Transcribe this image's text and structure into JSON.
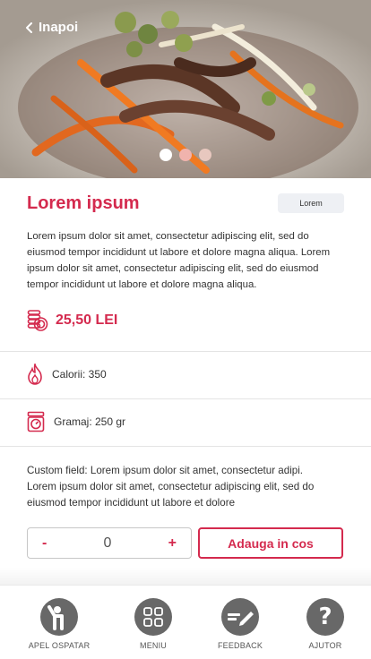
{
  "header": {
    "back_label": "Inapoi"
  },
  "carousel": {
    "slide_count": 3,
    "active_index": 0
  },
  "product": {
    "title": "Lorem ipsum",
    "tag": "Lorem",
    "description": "Lorem ipsum dolor sit amet, consectetur adipiscing elit, sed do eiusmod tempor incididunt ut labore et dolore magna aliqua. Lorem ipsum dolor sit amet, consectetur adipiscing elit, sed do eiusmod tempor incididunt ut labore et dolore magna aliqua.",
    "price": "25,50 LEI",
    "calories": "Calorii: 350",
    "weight": "Gramaj: 250 gr",
    "custom_field": "Custom field: Lorem ipsum dolor sit amet, consectetur adipi. Lorem ipsum dolor sit amet, consectetur adipiscing elit, sed do eiusmod tempor incididunt ut labore et dolore"
  },
  "cart": {
    "minus_label": "-",
    "quantity": "0",
    "plus_label": "+",
    "add_label": "Adauga in cos"
  },
  "nav": {
    "items": [
      {
        "label": "APEL OSPATAR",
        "icon": "waiter-icon"
      },
      {
        "label": "MENIU",
        "icon": "grid-icon"
      },
      {
        "label": "FEEDBACK",
        "icon": "feedback-pen-icon"
      },
      {
        "label": "AJUTOR",
        "icon": "question-icon"
      }
    ]
  },
  "colors": {
    "accent": "#d42a4e",
    "nav_icon_bg": "#686868"
  }
}
